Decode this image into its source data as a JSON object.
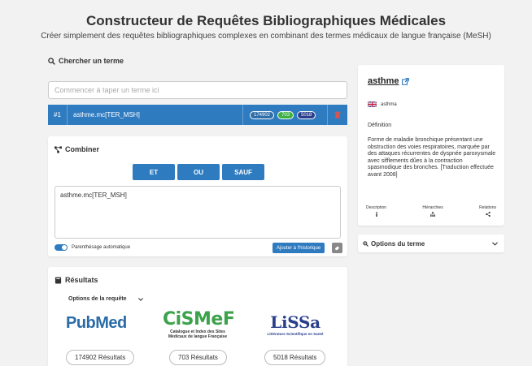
{
  "header": {
    "title": "Constructeur de Requêtes Bibliographiques Médicales",
    "subtitle": "Créer simplement des requêtes bibliographiques complexes en combinant des termes médicaux de langue française (MeSH)"
  },
  "search": {
    "heading": "Chercher un terme",
    "placeholder": "Commencer à taper un terme ici"
  },
  "term_rows": [
    {
      "index": "#1",
      "query": "asthme.mc[TER_MSH]",
      "pubmed": "174902",
      "cismef": "703",
      "lissa": "5018"
    }
  ],
  "combine": {
    "heading": "Combiner",
    "operators": [
      "ET",
      "OU",
      "SAUF"
    ],
    "query_text": "asthme.mc[TER_MSH]",
    "toggle_label": "Parenthésage automatique",
    "toggle_on": true,
    "add_history_label": "Ajouter à l'historique"
  },
  "results": {
    "heading": "Résultats",
    "options_label": "Options de la requête",
    "sources": [
      {
        "logo": "PubMed",
        "count_label": "174902 Résultats"
      },
      {
        "logo": "CiSMeF",
        "logo_sub": "Catalogue et Index des Sites Médicaux de langue Française",
        "count_label": "703 Résultats"
      },
      {
        "logo": "LiSSa",
        "logo_sub": "Littérature Scientifique en Santé",
        "count_label": "5018 Résultats"
      }
    ]
  },
  "term_detail": {
    "title": "asthme",
    "language_term": "asthma",
    "definition_heading": "Définition",
    "definition": "Forme de maladie bronchique présentant une obstruction des voies respiratoires, marquée par des attaques récurrentes de dyspnée paroxysmale avec sifflements dûes à la contraction spasmodique des bronches. [Traduction effectuée avant 2008]",
    "tabs": [
      "Description",
      "Hiérarchies",
      "Relations"
    ]
  },
  "term_options": {
    "label": "Options du terme"
  },
  "colors": {
    "primary": "#2f7bc0",
    "cismef_green": "#3ca24b",
    "lissa_navy": "#2a3e8c",
    "delete_red": "#d9534f"
  }
}
